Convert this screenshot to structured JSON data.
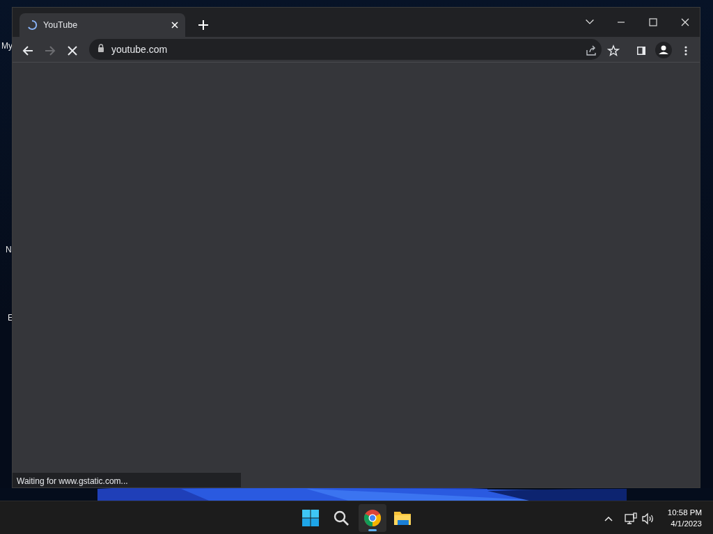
{
  "desktop": {
    "icon_labels": [
      "My",
      "N",
      "E"
    ]
  },
  "browser": {
    "tabs": [
      {
        "title": "YouTube",
        "loading": true,
        "selected": true
      }
    ],
    "address": "youtube.com",
    "loading": true,
    "forward_enabled": false,
    "status_text": "Waiting for www.gstatic.com..."
  },
  "taskbar": {
    "apps": [
      {
        "kind": "start",
        "active": false
      },
      {
        "kind": "search",
        "active": false
      },
      {
        "kind": "chrome",
        "active": true
      },
      {
        "kind": "explorer",
        "active": false
      }
    ],
    "time": "10:58 PM",
    "date": "4/1/2023"
  }
}
